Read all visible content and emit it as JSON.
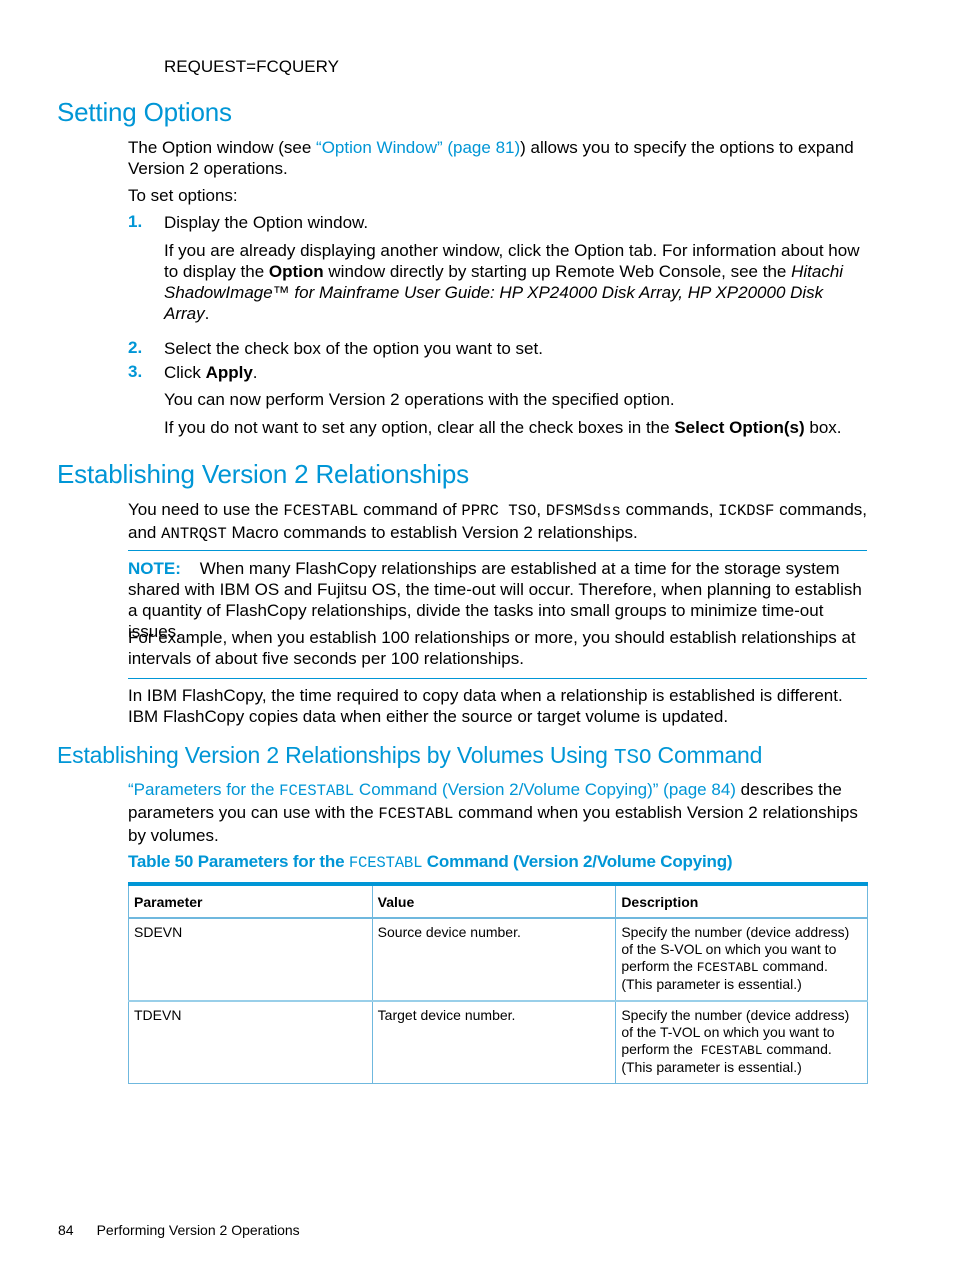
{
  "top_code_line": "REQUEST=FCQUERY",
  "section1": {
    "title": "Setting Options",
    "intro_before_link": "The Option window (see ",
    "intro_link": "“Option Window” (page 81)",
    "intro_after_link": ") allows you to specify the options to expand Version 2 operations.",
    "to_set": "To set options:",
    "steps": [
      {
        "number": "1.",
        "text": "Display the Option window.",
        "detail": {
          "before_bold": "If you are already displaying another window, click the Option tab. For information about how to display the ",
          "bold": "Option",
          "after_bold": " window directly by starting up Remote Web Console, see the ",
          "italic": "Hitachi ShadowImage™ for Mainframe User Guide: HP XP24000 Disk Array, HP XP20000 Disk Array",
          "end": "."
        }
      },
      {
        "number": "2.",
        "text": "Select the check box of the option you want to set."
      },
      {
        "number": "3.",
        "text_before_bold": "Click ",
        "bold": "Apply",
        "text_after_bold": ".",
        "followups": [
          "You can now perform Version 2 operations with the specified option."
        ],
        "last_before_bold": "If you do not want to set any option, clear all the check boxes in the ",
        "last_bold": "Select Option(s)",
        "last_after_bold": " box."
      }
    ]
  },
  "section2": {
    "title": "Establishing Version 2 Relationships",
    "para": {
      "t1": "You need to use the ",
      "c1": "FCESTABL",
      "t2": " command of ",
      "c2": "PPRC TSO",
      "t3": ", ",
      "c3": "DFSMSdss",
      "t4": " commands, ",
      "c4": "ICKDSF",
      "t5": " commands, and ",
      "c5": "ANTRQST",
      "t6": " Macro commands to establish Version 2 relationships."
    },
    "note": {
      "label": "NOTE:",
      "text": "When many FlashCopy relationships are established at a time for the storage system shared with IBM OS and Fujitsu OS, the time-out will occur. Therefore, when planning to establish a quantity of FlashCopy relationships, divide the tasks into small groups to minimize time-out issues.",
      "text2": "For example, when you establish 100 relationships or more, you should establish relationships at intervals of about five seconds per 100 relationships."
    },
    "para2": "In IBM FlashCopy, the time required to copy data when a relationship is established is different. IBM FlashCopy copies data when either the source or target volume is updated."
  },
  "section3": {
    "title_before_code": "Establishing Version 2 Relationships by Volumes Using ",
    "title_code": "TSO",
    "title_after_code": " Command",
    "link_before_code": "“Parameters for the ",
    "link_code": "FCESTABL",
    "link_after_code": " Command (Version 2/Volume Copying)” (page 84)",
    "text1": " describes the parameters you can use with the ",
    "code2": "FCESTABL",
    "text2": " command when you establish Version 2 relationships by volumes."
  },
  "table": {
    "caption_before_code": "Table 50 Parameters for the ",
    "caption_code": "FCESTABL",
    "caption_after_code": " Command (Version 2/Volume Copying)",
    "headers": [
      "Parameter",
      "Value",
      "Description"
    ],
    "rows": [
      {
        "parameter": "SDEVN",
        "value": "Source device number.",
        "desc_before_code": "Specify the number (device address) of the S-VOL on which you want to perform the ",
        "desc_code": "FCESTABL",
        "desc_after_code": " command. (This parameter is essential.)"
      },
      {
        "parameter": "TDEVN",
        "value": "Target device number.",
        "desc_before_code": "Specify the number (device address) of the T-VOL on which you want to perform the  ",
        "desc_code": "FCESTABL",
        "desc_after_code": " command. (This parameter is essential.)"
      }
    ]
  },
  "footer": {
    "page_number": "84",
    "chapter": "Performing Version 2 Operations"
  }
}
